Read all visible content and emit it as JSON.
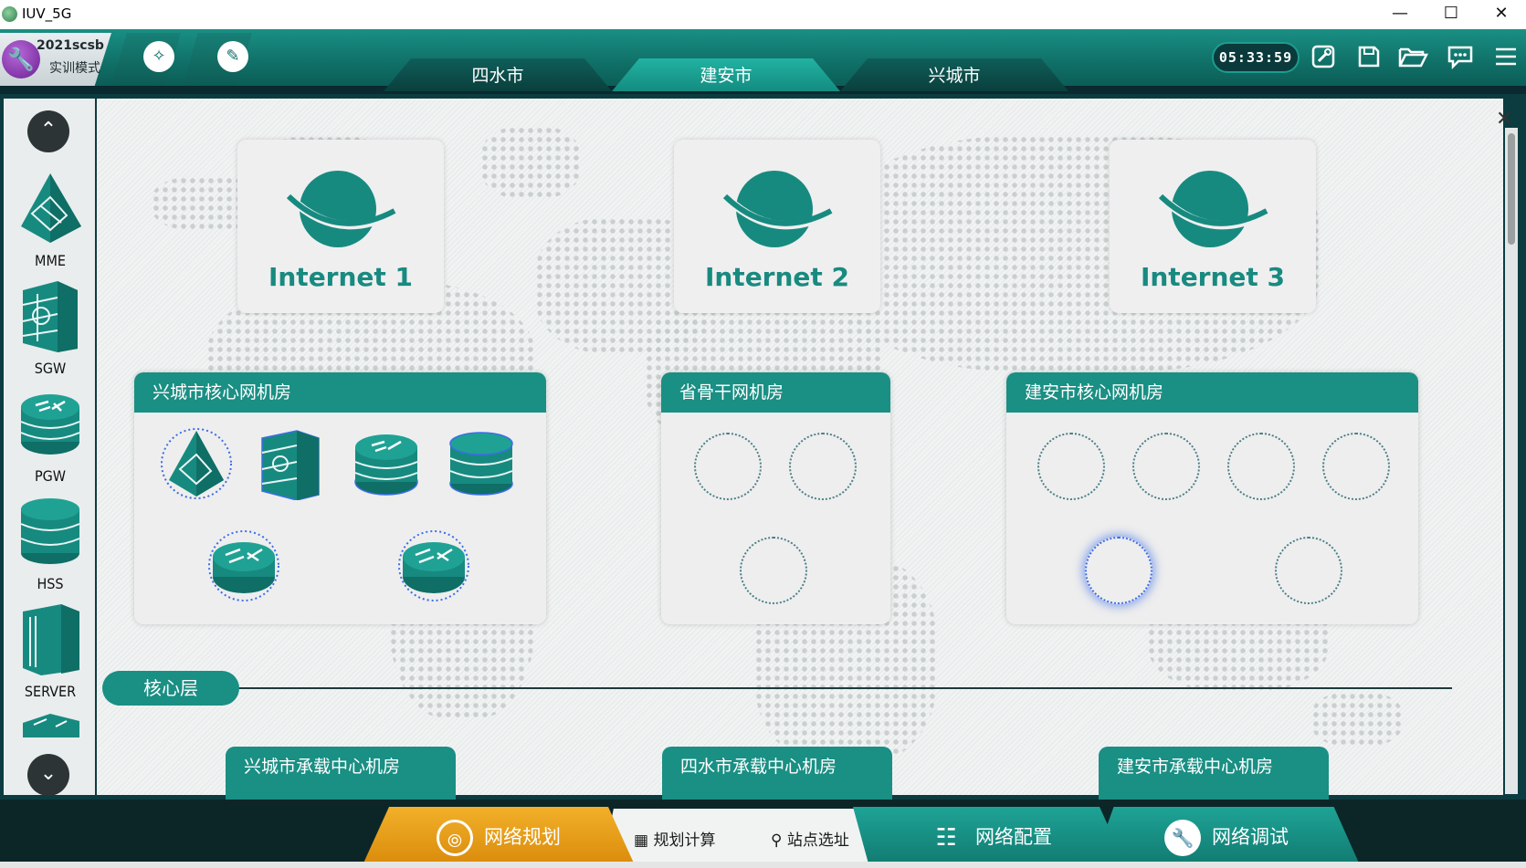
{
  "window": {
    "title": "IUV_5G",
    "minimize_glyph": "—",
    "maximize_glyph": "☐",
    "close_glyph": "✕"
  },
  "toolbar": {
    "year": "2021scsb",
    "mode": "实训模式",
    "clock": "05:33:59",
    "icons": [
      "topology-icon",
      "edit-icon",
      "settings-tool-icon",
      "save-icon",
      "open-folder-icon",
      "chat-icon",
      "menu-icon"
    ]
  },
  "city_tabs": {
    "items": [
      {
        "label": "四水市",
        "active": false
      },
      {
        "label": "建安市",
        "active": true
      },
      {
        "label": "兴城市",
        "active": false
      }
    ]
  },
  "device_panel": {
    "items": [
      {
        "label": "MME"
      },
      {
        "label": "SGW"
      },
      {
        "label": "PGW"
      },
      {
        "label": "HSS"
      },
      {
        "label": "SERVER"
      }
    ]
  },
  "internet": {
    "items": [
      {
        "label": "Internet 1"
      },
      {
        "label": "Internet 2"
      },
      {
        "label": "Internet 3"
      }
    ]
  },
  "rooms": {
    "xingcheng_core": {
      "title": "兴城市核心网机房"
    },
    "province_backbone": {
      "title": "省骨干网机房"
    },
    "jianan_core": {
      "title": "建安市核心网机房"
    }
  },
  "layer": {
    "label": "核心层"
  },
  "bearer_rooms": {
    "items": [
      {
        "title": "兴城市承载中心机房"
      },
      {
        "title": "四水市承载中心机房"
      },
      {
        "title": "建安市承载中心机房"
      }
    ]
  },
  "bottom_nav": {
    "planning": "网络规划",
    "calc": "规划计算",
    "site": "站点选址",
    "config": "网络配置",
    "debug": "网络调试"
  },
  "colors": {
    "accent": "#1a8f84",
    "planning_active": "#e89b18",
    "dark": "#0c2628"
  }
}
